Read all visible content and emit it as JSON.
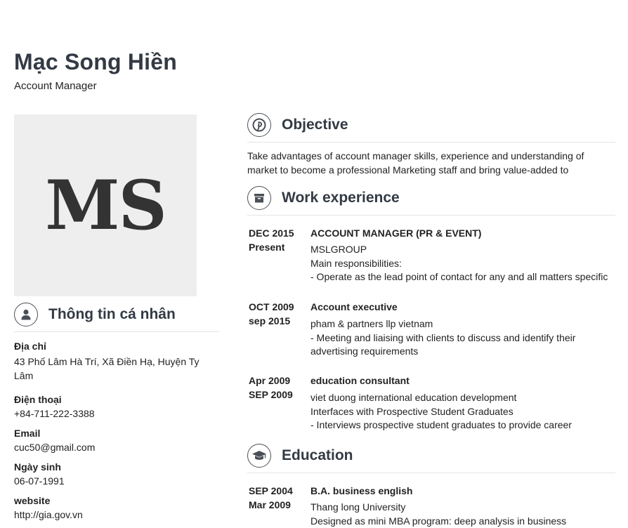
{
  "profile": {
    "name": "Mạc Song Hiền",
    "job_title": "Account Manager",
    "initials": "MS"
  },
  "personal": {
    "heading": "Thông tin cá nhân",
    "icon": "user-icon",
    "address_label": "Địa chỉ",
    "address_value": "43 Phố Lâm Hà Trí, Xã Điền Hạ, Huyện Ty Lâm",
    "phone_label": "Điện thoại",
    "phone_value": "+84-711-222-3388",
    "email_label": "Email",
    "email_value": "cuc50@gmail.com",
    "birthday_label": "Ngày sinh",
    "birthday_value": "06-07-1991",
    "website_label": "website",
    "website_value": "http://gia.gov.vn"
  },
  "objective": {
    "heading": "Objective",
    "icon": "pinterest-icon",
    "text": "Take advantages of account manager skills, experience and understanding of market to become a professional Marketing staff and bring value-added to"
  },
  "work": {
    "heading": "Work experience",
    "icon": "archive-icon",
    "entries": [
      {
        "date_from": "DEC 2015",
        "date_to": "Present",
        "title": "ACCOUNT MANAGER (PR & EVENT)",
        "body": "MSLGROUP\nMain responsibilities:\n- Operate as the lead point of contact for any and all matters specific"
      },
      {
        "date_from": "OCT 2009",
        "date_to": "sep 2015",
        "title": "Account executive",
        "body": "pham & partners llp vietnam\n- Meeting and liaising with clients to discuss and identify their advertising requirements"
      },
      {
        "date_from": "Apr 2009",
        "date_to": "SEP 2009",
        "title": "education consultant",
        "body": "viet duong international education development\nInterfaces with Prospective Student Graduates\n- Interviews prospective student graduates to provide career"
      }
    ]
  },
  "education": {
    "heading": "Education",
    "icon": "graduation-cap-icon",
    "entries": [
      {
        "date_from": "SEP 2004",
        "date_to": "Mar 2009",
        "title": "B.A. business english",
        "body": "Thang long University\nDesigned as mini MBA program: deep analysis in business"
      }
    ]
  },
  "colors": {
    "heading": "#333a44",
    "text": "#222222",
    "avatar_bg": "#eeeeee",
    "rule": "#e5e5e5"
  }
}
